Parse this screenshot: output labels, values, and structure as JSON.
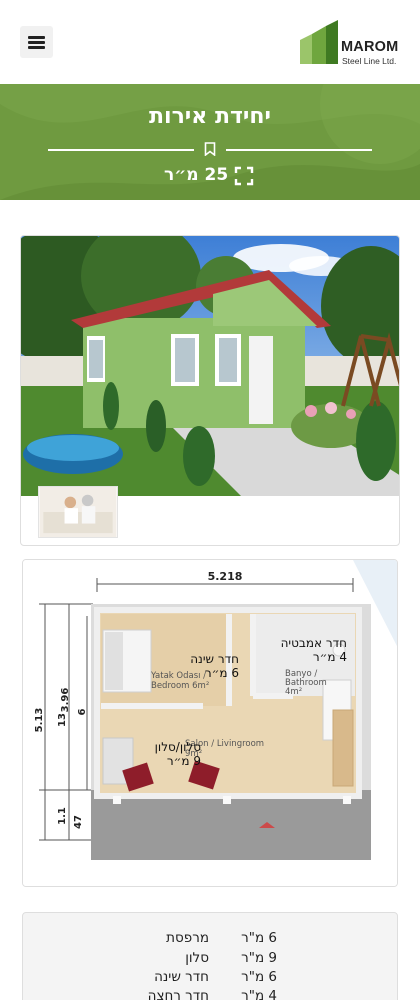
{
  "header": {
    "menu_icon": "hamburger-icon",
    "logo_icon": "marom-logo-mark",
    "logo_name": "MAROM",
    "logo_tagline": "Steel Line Ltd."
  },
  "banner": {
    "title": "יחידת אירות",
    "divider_icon": "bookmark-icon",
    "area_icon": "expand-icon",
    "area": "25 מ״ר"
  },
  "floor_plan": {
    "dim_top": "5.218",
    "dim_left_outer": "5.13",
    "dim_left_a": "13",
    "dim_left_b": "3.96",
    "dim_left_c": "6",
    "dim_left_d": "1.1",
    "dim_left_e": "47",
    "plan_bedroom_text": [
      "Yatak Odası /",
      "Bedroom 6m²"
    ],
    "plan_bath_text": [
      "Banyo /",
      "Bathroom",
      "4m²"
    ],
    "plan_living_text": [
      "Salon / Livingroom",
      "9m²"
    ],
    "overlay_bedroom": [
      "חדר שינה",
      "6 מ״ר"
    ],
    "overlay_bath": [
      "חדר אמבטיה",
      "4 מ״ר"
    ],
    "overlay_salon": [
      "סלון/סלון",
      "9 מ״ר"
    ]
  },
  "areas_table": [
    {
      "size": "6 מ\"ר",
      "room": "מרפסת"
    },
    {
      "size": "9 מ\"ר",
      "room": "סלון"
    },
    {
      "size": "6 מ\"ר",
      "room": "חדר שינה"
    },
    {
      "size": "4 מ\"ר",
      "room": "חדר רחצה"
    }
  ],
  "colors": {
    "banner_green": "#6f9a40",
    "logo_green_dark": "#4f8a2b",
    "logo_green_light": "#9bc56a"
  }
}
